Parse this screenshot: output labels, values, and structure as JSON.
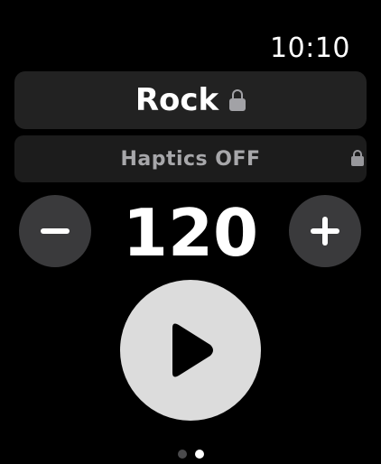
{
  "status_bar": {
    "time": "10:10"
  },
  "genre": {
    "label": "Rock",
    "locked": true,
    "icon": "lock-icon"
  },
  "haptics": {
    "label": "Haptics OFF",
    "locked": true,
    "icon": "lock-icon"
  },
  "tempo": {
    "bpm": "120",
    "decrease_icon": "minus-icon",
    "increase_icon": "plus-icon"
  },
  "playback": {
    "icon": "play-icon"
  },
  "pager": {
    "page_count": 2,
    "current_page": 2
  },
  "colors": {
    "background": "#000000",
    "button_fill": "#3a3a3c",
    "play_fill": "#dcdcdc",
    "secondary_text": "#a7a7aa"
  }
}
